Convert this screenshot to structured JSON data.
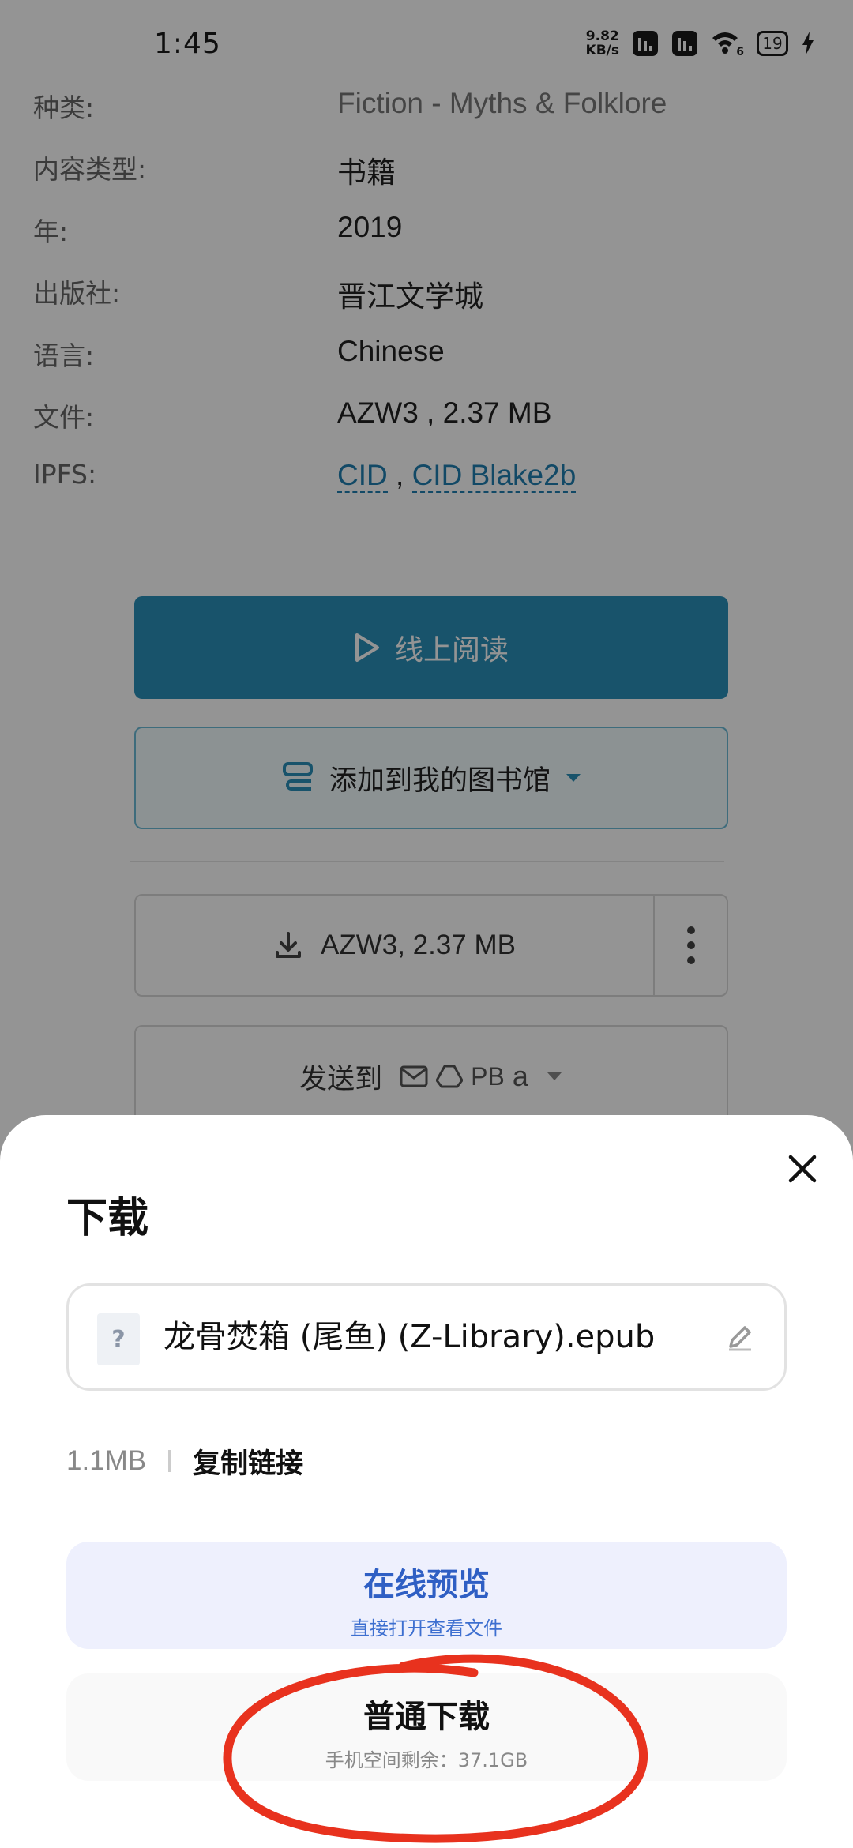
{
  "status_bar": {
    "time": "1:45",
    "net_speed_value": "9.82",
    "net_speed_unit": "KB/s",
    "wifi_badge": "6",
    "battery": "19"
  },
  "details": {
    "category": {
      "label": "种类:",
      "value": "Fiction - Myths & Folklore"
    },
    "content_type": {
      "label": "内容类型:",
      "value": "书籍"
    },
    "year": {
      "label": "年:",
      "value": "2019"
    },
    "publisher": {
      "label": "出版社:",
      "value": "晋江文学城"
    },
    "language": {
      "label": "语言:",
      "value": "Chinese"
    },
    "file": {
      "label": "文件:",
      "value": "AZW3 , 2.37 MB"
    },
    "ipfs": {
      "label": "IPFS:",
      "cid": "CID",
      "separator": " , ",
      "cid_blake": "CID Blake2b"
    }
  },
  "buttons": {
    "read_online": "线上阅读",
    "add_library": "添加到我的图书馆",
    "file_download": "AZW3, 2.37 MB",
    "send_to": "发送到",
    "send_pb": "PB"
  },
  "sheet": {
    "title": "下载",
    "file_name": "龙骨焚箱 (尾鱼) (Z-Library).epub",
    "file_icon_glyph": "?",
    "size": "1.1MB",
    "copy_link": "复制链接",
    "preview_label": "在线预览",
    "preview_sub": "直接打开查看文件",
    "download_label": "普通下载",
    "download_sub": "手机空间剩余：37.1GB"
  },
  "colors": {
    "accent_teal": "#2a8fb8",
    "preview_blue": "#2f5fc4",
    "annotation_red": "#e8321e"
  }
}
